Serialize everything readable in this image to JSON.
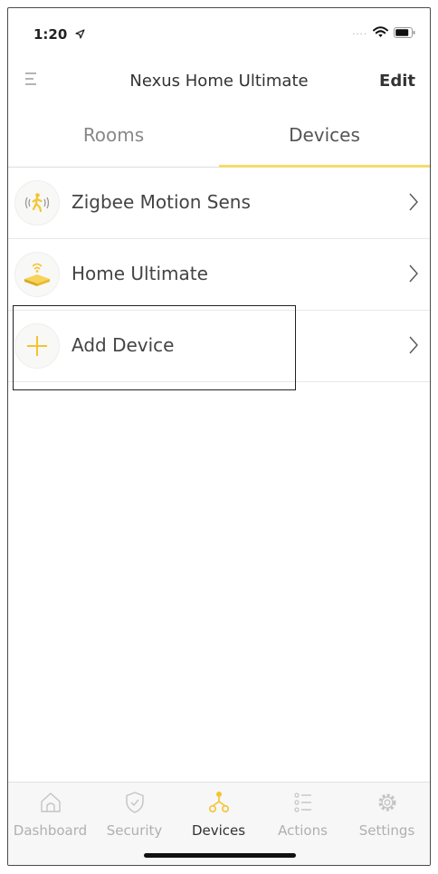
{
  "status_bar": {
    "time": "1:20",
    "signal": "....",
    "location_icon": "location-arrow-icon",
    "wifi_icon": "wifi-icon",
    "battery_icon": "battery-icon"
  },
  "header": {
    "menu_icon": "menu-icon",
    "title": "Nexus Home Ultimate",
    "edit_label": "Edit"
  },
  "tabs": [
    {
      "label": "Rooms",
      "active": false
    },
    {
      "label": "Devices",
      "active": true
    }
  ],
  "colors": {
    "accent": "#f2dd6d",
    "icon_yellow": "#f4c430",
    "text": "#444444",
    "muted": "#b0b0b0"
  },
  "devices": [
    {
      "label": "Zigbee Motion Sens",
      "icon": "motion-sensor-icon"
    },
    {
      "label": "Home Ultimate",
      "icon": "hub-router-icon"
    },
    {
      "label": "Add Device",
      "icon": "plus-icon"
    }
  ],
  "bottom_nav": [
    {
      "label": "Dashboard",
      "icon": "home-icon",
      "active": false
    },
    {
      "label": "Security",
      "icon": "shield-icon",
      "active": false
    },
    {
      "label": "Devices",
      "icon": "devices-icon",
      "active": true
    },
    {
      "label": "Actions",
      "icon": "list-icon",
      "active": false
    },
    {
      "label": "Settings",
      "icon": "gear-icon",
      "active": false
    }
  ]
}
